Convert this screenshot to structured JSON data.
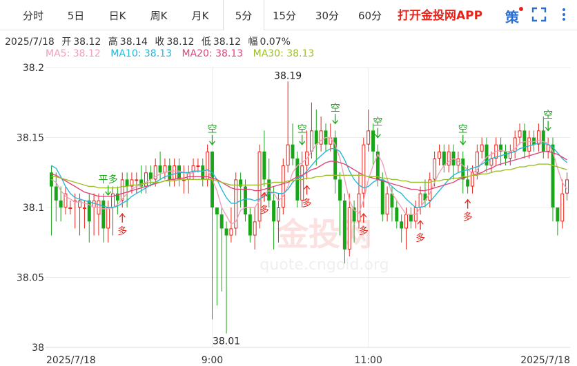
{
  "tabs": {
    "items": [
      "分时",
      "5日",
      "日K",
      "周K",
      "月K",
      "5分",
      "15分",
      "30分",
      "60分"
    ],
    "active": "5分"
  },
  "app_link": "打开金投网APP",
  "icons": {
    "ce": "策",
    "fullscreen": "fullscreen-icon",
    "more": "more-vertical-icon"
  },
  "info": {
    "date": "2025/7/18",
    "open_label": "开",
    "open": "38.12",
    "high_label": "高",
    "high": "38.14",
    "close_label": "收",
    "close": "38.12",
    "low_label": "低",
    "low": "38.12",
    "amp_label": "幅",
    "amp": "0.07%"
  },
  "ma": [
    {
      "label": "MA5: 38.12",
      "color": "#f0a0b8"
    },
    {
      "label": "MA10: 38.13",
      "color": "#29b6d6"
    },
    {
      "label": "MA20: 38.13",
      "color": "#e0457a"
    },
    {
      "label": "MA30: 38.13",
      "color": "#9cbf2b"
    }
  ],
  "colors": {
    "up": "#e8231a",
    "down": "#18a618",
    "grid": "#ececec",
    "axis_text": "#333333"
  },
  "watermark": {
    "text": "金投网",
    "url": "quote.cngold.org"
  },
  "chart_data": {
    "type": "candlestick",
    "y_ticks": [
      38.2,
      38.15,
      38.1,
      38.05,
      38.0
    ],
    "ylim": [
      38.0,
      38.2
    ],
    "x_labels": [
      {
        "index": 0,
        "label": "2025/7/18"
      },
      {
        "index": 34,
        "label": "9:00"
      },
      {
        "index": 67,
        "label": "11:00"
      },
      {
        "index": 109,
        "label": "2025/7/18"
      }
    ],
    "candles": [
      [
        38.125,
        38.115,
        38.13,
        38.08
      ],
      [
        38.115,
        38.105,
        38.125,
        38.09
      ],
      [
        38.105,
        38.1,
        38.115,
        38.09
      ],
      [
        38.1,
        38.11,
        38.115,
        38.095
      ],
      [
        38.1,
        38.1,
        38.105,
        38.095
      ],
      [
        38.105,
        38.105,
        38.11,
        38.085
      ],
      [
        38.1,
        38.105,
        38.11,
        38.08
      ],
      [
        38.1,
        38.1,
        38.105,
        38.085
      ],
      [
        38.105,
        38.09,
        38.11,
        38.075
      ],
      [
        38.1,
        38.105,
        38.11,
        38.08
      ],
      [
        38.095,
        38.105,
        38.11,
        38.08
      ],
      [
        38.105,
        38.085,
        38.11,
        38.075
      ],
      [
        38.085,
        38.1,
        38.105,
        38.075
      ],
      [
        38.1,
        38.11,
        38.115,
        38.08
      ],
      [
        38.11,
        38.105,
        38.115,
        38.095
      ],
      [
        38.105,
        38.12,
        38.125,
        38.1
      ],
      [
        38.12,
        38.115,
        38.125,
        38.1
      ],
      [
        38.115,
        38.12,
        38.125,
        38.11
      ],
      [
        38.12,
        38.12,
        38.125,
        38.11
      ],
      [
        38.12,
        38.115,
        38.13,
        38.11
      ],
      [
        38.115,
        38.125,
        38.13,
        38.11
      ],
      [
        38.125,
        38.12,
        38.13,
        38.115
      ],
      [
        38.12,
        38.13,
        38.135,
        38.115
      ],
      [
        38.13,
        38.125,
        38.14,
        38.12
      ],
      [
        38.125,
        38.13,
        38.135,
        38.12
      ],
      [
        38.13,
        38.12,
        38.135,
        38.115
      ],
      [
        38.12,
        38.13,
        38.135,
        38.115
      ],
      [
        38.13,
        38.12,
        38.135,
        38.115
      ],
      [
        38.12,
        38.12,
        38.13,
        38.11
      ],
      [
        38.12,
        38.125,
        38.13,
        38.11
      ],
      [
        38.125,
        38.13,
        38.135,
        38.12
      ],
      [
        38.13,
        38.13,
        38.135,
        38.125
      ],
      [
        38.13,
        38.12,
        38.135,
        38.115
      ],
      [
        38.12,
        38.14,
        38.145,
        38.115
      ],
      [
        38.14,
        38.1,
        38.14,
        38.02
      ],
      [
        38.1,
        38.095,
        38.1,
        38.03
      ],
      [
        38.095,
        38.085,
        38.1,
        38.04
      ],
      [
        38.085,
        38.08,
        38.09,
        38.01
      ],
      [
        38.08,
        38.085,
        38.1,
        38.075
      ],
      [
        38.085,
        38.12,
        38.125,
        38.08
      ],
      [
        38.12,
        38.115,
        38.125,
        38.1
      ],
      [
        38.115,
        38.095,
        38.12,
        38.09
      ],
      [
        38.095,
        38.08,
        38.1,
        38.075
      ],
      [
        38.08,
        38.09,
        38.1,
        38.07
      ],
      [
        38.09,
        38.14,
        38.145,
        38.085
      ],
      [
        38.14,
        38.12,
        38.155,
        38.115
      ],
      [
        38.12,
        38.105,
        38.135,
        38.1
      ],
      [
        38.105,
        38.09,
        38.115,
        38.07
      ],
      [
        38.09,
        38.1,
        38.11,
        38.075
      ],
      [
        38.1,
        38.13,
        38.135,
        38.095
      ],
      [
        38.13,
        38.145,
        38.19,
        38.125
      ],
      [
        38.145,
        38.135,
        38.16,
        38.13
      ],
      [
        38.135,
        38.105,
        38.14,
        38.1
      ],
      [
        38.105,
        38.13,
        38.14,
        38.1
      ],
      [
        38.13,
        38.14,
        38.155,
        38.12
      ],
      [
        38.14,
        38.155,
        38.175,
        38.135
      ],
      [
        38.155,
        38.145,
        38.17,
        38.13
      ],
      [
        38.145,
        38.155,
        38.165,
        38.14
      ],
      [
        38.155,
        38.145,
        38.16,
        38.14
      ],
      [
        38.145,
        38.15,
        38.16,
        38.14
      ],
      [
        38.15,
        38.12,
        38.155,
        38.11
      ],
      [
        38.12,
        38.105,
        38.125,
        38.08
      ],
      [
        38.105,
        38.07,
        38.11,
        38.06
      ],
      [
        38.07,
        38.1,
        38.11,
        38.065
      ],
      [
        38.1,
        38.09,
        38.105,
        38.075
      ],
      [
        38.09,
        38.11,
        38.125,
        38.085
      ],
      [
        38.11,
        38.145,
        38.15,
        38.1
      ],
      [
        38.145,
        38.155,
        38.17,
        38.14
      ],
      [
        38.155,
        38.14,
        38.16,
        38.13
      ],
      [
        38.14,
        38.12,
        38.145,
        38.115
      ],
      [
        38.12,
        38.095,
        38.125,
        38.09
      ],
      [
        38.095,
        38.11,
        38.115,
        38.09
      ],
      [
        38.11,
        38.1,
        38.115,
        38.09
      ],
      [
        38.1,
        38.09,
        38.105,
        38.085
      ],
      [
        38.09,
        38.085,
        38.095,
        38.075
      ],
      [
        38.085,
        38.095,
        38.1,
        38.07
      ],
      [
        38.095,
        38.09,
        38.1,
        38.085
      ],
      [
        38.09,
        38.1,
        38.105,
        38.085
      ],
      [
        38.1,
        38.11,
        38.115,
        38.095
      ],
      [
        38.11,
        38.105,
        38.12,
        38.1
      ],
      [
        38.105,
        38.12,
        38.125,
        38.1
      ],
      [
        38.12,
        38.135,
        38.14,
        38.115
      ],
      [
        38.135,
        38.14,
        38.145,
        38.13
      ],
      [
        38.14,
        38.13,
        38.145,
        38.125
      ],
      [
        38.13,
        38.14,
        38.145,
        38.125
      ],
      [
        38.14,
        38.13,
        38.145,
        38.12
      ],
      [
        38.13,
        38.135,
        38.14,
        38.125
      ],
      [
        38.135,
        38.12,
        38.14,
        38.11
      ],
      [
        38.12,
        38.115,
        38.13,
        38.11
      ],
      [
        38.115,
        38.125,
        38.13,
        38.11
      ],
      [
        38.125,
        38.14,
        38.145,
        38.12
      ],
      [
        38.14,
        38.145,
        38.15,
        38.135
      ],
      [
        38.145,
        38.13,
        38.15,
        38.125
      ],
      [
        38.13,
        38.135,
        38.14,
        38.125
      ],
      [
        38.135,
        38.145,
        38.15,
        38.13
      ],
      [
        38.145,
        38.14,
        38.15,
        38.13
      ],
      [
        38.14,
        38.135,
        38.145,
        38.13
      ],
      [
        38.135,
        38.14,
        38.145,
        38.13
      ],
      [
        38.14,
        38.15,
        38.155,
        38.135
      ],
      [
        38.15,
        38.155,
        38.16,
        38.145
      ],
      [
        38.155,
        38.14,
        38.16,
        38.135
      ],
      [
        38.14,
        38.15,
        38.155,
        38.135
      ],
      [
        38.15,
        38.145,
        38.155,
        38.14
      ],
      [
        38.145,
        38.155,
        38.16,
        38.14
      ],
      [
        38.155,
        38.14,
        38.165,
        38.135
      ],
      [
        38.14,
        38.145,
        38.15,
        38.135
      ],
      [
        38.145,
        38.1,
        38.15,
        38.09
      ],
      [
        38.1,
        38.09,
        38.1,
        38.08
      ],
      [
        38.09,
        38.11,
        38.12,
        38.085
      ],
      [
        38.11,
        38.12,
        38.125,
        38.105
      ]
    ],
    "ma": {
      "MA5": [
        38.12,
        38.118,
        38.112,
        38.108,
        38.106,
        38.104,
        38.104,
        38.103,
        38.102,
        38.1,
        38.1,
        38.099,
        38.099,
        38.1,
        38.102,
        38.106,
        38.11,
        38.113,
        38.115,
        38.116,
        38.118,
        38.12,
        38.122,
        38.124,
        38.125,
        38.126,
        38.126,
        38.126,
        38.125,
        38.124,
        38.125,
        38.126,
        38.126,
        38.127,
        38.12,
        38.112,
        38.1,
        38.094,
        38.088,
        38.09,
        38.098,
        38.1,
        38.1,
        38.1,
        38.105,
        38.11,
        38.112,
        38.11,
        38.105,
        38.108,
        38.115,
        38.125,
        38.13,
        38.132,
        38.135,
        38.14,
        38.145,
        38.148,
        38.15,
        38.15,
        38.145,
        38.135,
        38.12,
        38.105,
        38.098,
        38.096,
        38.105,
        38.12,
        38.13,
        38.138,
        38.132,
        38.12,
        38.11,
        38.105,
        38.1,
        38.095,
        38.095,
        38.095,
        38.1,
        38.105,
        38.11,
        38.118,
        38.125,
        38.13,
        38.133,
        38.135,
        38.133,
        38.13,
        38.127,
        38.125,
        38.127,
        38.132,
        38.136,
        38.138,
        38.14,
        38.141,
        38.14,
        38.14,
        38.142,
        38.146,
        38.147,
        38.147,
        38.147,
        38.148,
        38.147,
        38.146,
        38.14,
        38.128,
        38.118,
        38.113
      ],
      "MA10": [
        38.13,
        38.128,
        38.122,
        38.115,
        38.11,
        38.107,
        38.106,
        38.105,
        38.104,
        38.103,
        38.102,
        38.101,
        38.1,
        38.1,
        38.101,
        38.103,
        38.105,
        38.108,
        38.11,
        38.112,
        38.114,
        38.116,
        38.118,
        38.12,
        38.122,
        38.123,
        38.124,
        38.125,
        38.125,
        38.125,
        38.126,
        38.126,
        38.126,
        38.127,
        38.125,
        38.12,
        38.113,
        38.107,
        38.103,
        38.103,
        38.105,
        38.106,
        38.106,
        38.105,
        38.106,
        38.108,
        38.11,
        38.111,
        38.11,
        38.11,
        38.113,
        38.118,
        38.121,
        38.122,
        38.126,
        38.13,
        38.134,
        38.137,
        38.14,
        38.142,
        38.142,
        38.14,
        38.134,
        38.126,
        38.12,
        38.116,
        38.114,
        38.115,
        38.118,
        38.12,
        38.12,
        38.118,
        38.115,
        38.112,
        38.11,
        38.106,
        38.103,
        38.1,
        38.1,
        38.101,
        38.104,
        38.108,
        38.112,
        38.116,
        38.12,
        38.123,
        38.125,
        38.126,
        38.127,
        38.128,
        38.129,
        38.131,
        38.133,
        38.135,
        38.136,
        38.137,
        38.138,
        38.139,
        38.14,
        38.142,
        38.143,
        38.144,
        38.145,
        38.146,
        38.146,
        38.145,
        38.143,
        38.139,
        38.135,
        38.132
      ],
      "MA20": [
        38.124,
        38.123,
        38.121,
        38.119,
        38.117,
        38.115,
        38.113,
        38.111,
        38.11,
        38.109,
        38.108,
        38.108,
        38.108,
        38.108,
        38.109,
        38.11,
        38.111,
        38.112,
        38.113,
        38.114,
        38.115,
        38.116,
        38.117,
        38.118,
        38.119,
        38.12,
        38.12,
        38.121,
        38.121,
        38.122,
        38.122,
        38.122,
        38.122,
        38.122,
        38.121,
        38.12,
        38.118,
        38.116,
        38.114,
        38.113,
        38.113,
        38.113,
        38.113,
        38.112,
        38.112,
        38.113,
        38.114,
        38.115,
        38.116,
        38.117,
        38.118,
        38.12,
        38.122,
        38.123,
        38.125,
        38.127,
        38.128,
        38.13,
        38.132,
        38.133,
        38.133,
        38.132,
        38.131,
        38.129,
        38.127,
        38.125,
        38.123,
        38.122,
        38.121,
        38.12,
        38.119,
        38.118,
        38.117,
        38.116,
        38.115,
        38.114,
        38.113,
        38.113,
        38.112,
        38.112,
        38.113,
        38.114,
        38.115,
        38.116,
        38.117,
        38.118,
        38.12,
        38.121,
        38.122,
        38.123,
        38.124,
        38.125,
        38.127,
        38.128,
        38.13,
        38.131,
        38.132,
        38.133,
        38.134,
        38.135,
        38.136,
        38.137,
        38.138,
        38.139,
        38.14,
        38.14,
        38.139,
        38.138,
        38.136,
        38.134
      ],
      "MA30": [
        38.122,
        38.122,
        38.121,
        38.12,
        38.119,
        38.118,
        38.117,
        38.116,
        38.115,
        38.115,
        38.114,
        38.114,
        38.114,
        38.114,
        38.114,
        38.115,
        38.115,
        38.116,
        38.116,
        38.117,
        38.117,
        38.118,
        38.118,
        38.118,
        38.119,
        38.119,
        38.119,
        38.12,
        38.12,
        38.12,
        38.12,
        38.12,
        38.12,
        38.12,
        38.12,
        38.119,
        38.118,
        38.117,
        38.116,
        38.116,
        38.116,
        38.116,
        38.116,
        38.116,
        38.116,
        38.117,
        38.117,
        38.118,
        38.118,
        38.118,
        38.119,
        38.119,
        38.12,
        38.12,
        38.121,
        38.121,
        38.122,
        38.122,
        38.123,
        38.123,
        38.123,
        38.123,
        38.123,
        38.123,
        38.123,
        38.123,
        38.123,
        38.122,
        38.122,
        38.122,
        38.121,
        38.121,
        38.12,
        38.12,
        38.119,
        38.119,
        38.118,
        38.118,
        38.118,
        38.118,
        38.118,
        38.119,
        38.119,
        38.12,
        38.12,
        38.121,
        38.121,
        38.122,
        38.122,
        38.123,
        38.123,
        38.124,
        38.124,
        38.125,
        38.126,
        38.126,
        38.127,
        38.127,
        38.128,
        38.129,
        38.129,
        38.13,
        38.13,
        38.131,
        38.131,
        38.131,
        38.13,
        38.129,
        38.128,
        38.127
      ]
    },
    "annotations": [
      {
        "index": 50,
        "value": 38.19,
        "label": "38.19",
        "type": "high"
      },
      {
        "index": 37,
        "value": 38.01,
        "label": "38.01",
        "type": "low"
      }
    ],
    "signals": [
      {
        "index": 12,
        "type": "pingduo",
        "label": "平多"
      },
      {
        "index": 15,
        "type": "buy",
        "label": "多"
      },
      {
        "index": 34,
        "type": "sell",
        "label": "空"
      },
      {
        "index": 45,
        "type": "buy",
        "label": "多"
      },
      {
        "index": 53,
        "type": "sell",
        "label": "空"
      },
      {
        "index": 54,
        "type": "buy",
        "label": "多"
      },
      {
        "index": 60,
        "type": "sell",
        "label": "空"
      },
      {
        "index": 66,
        "type": "buy",
        "label": "多"
      },
      {
        "index": 69,
        "type": "sell",
        "label": "空"
      },
      {
        "index": 78,
        "type": "buy",
        "label": "多"
      },
      {
        "index": 87,
        "type": "sell",
        "label": "空"
      },
      {
        "index": 88,
        "type": "buy",
        "label": "多"
      },
      {
        "index": 105,
        "type": "sell",
        "label": "空"
      }
    ]
  }
}
